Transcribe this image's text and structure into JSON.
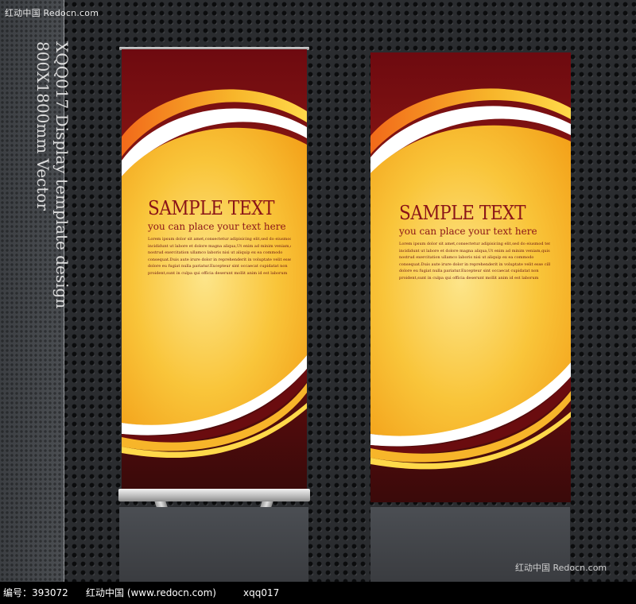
{
  "watermark": {
    "top": "红动中国 Redocn.com",
    "corner": "红动中国 Redocn.com"
  },
  "side_title": {
    "line1": "XQQ017 Display template design",
    "line2": "800X1800mm Vector"
  },
  "banners": [
    {
      "headline": "SAMPLE TEXT",
      "subhead": "you can place your text here",
      "body": [
        "Lorem ipsum dolor sit amet,consectetur adipisicing elit,sed do eiusmod tempor",
        "incididunt ut labore et dolore magna aliqua,Ut enim ad minim veniam,quis",
        "nostrud exercitation ullamco laboris nisi ut aliquip ex ea commodo",
        "consequat.Duis aute irure dolor in reprehenderit in voluptate velit esse cillum",
        "dolore eu fugiat nulla pariatur.Excepteur sint occaecat cupidatat non",
        "proident,sunt in culpa qui officia deserunt mollit anim id est laborum"
      ]
    },
    {
      "headline": "SAMPLE TEXT",
      "subhead": "you can place your text here",
      "body": [
        "Lorem ipsum dolor sit amet,consectetur adipisicing elit,sed do eiusmod tempor",
        "incididunt ut labore et dolore magna aliqua,Ut enim ad minim veniam,quis",
        "nostrud exercitation ullamco laboris nisi ut aliquip ex ea commodo",
        "consequat.Duis aute irure dolor in reprehenderit in voluptate velit esse cillum",
        "dolore eu fugiat nulla pariatur.Excepteur sint occaecat cupidatat non",
        "proident,sunt in culpa qui officia deserunt mollit anim id est laborum"
      ]
    }
  ],
  "footer": {
    "id_text": "编号：393072",
    "site_text": "红动中国 (www.redocn.com)",
    "code_text": "xqq017"
  },
  "colors": {
    "banner_dark_red": "#7a0f12",
    "banner_yellow": "#f6c22a",
    "banner_orange": "#f08a1e",
    "text_red": "#8a1418"
  }
}
